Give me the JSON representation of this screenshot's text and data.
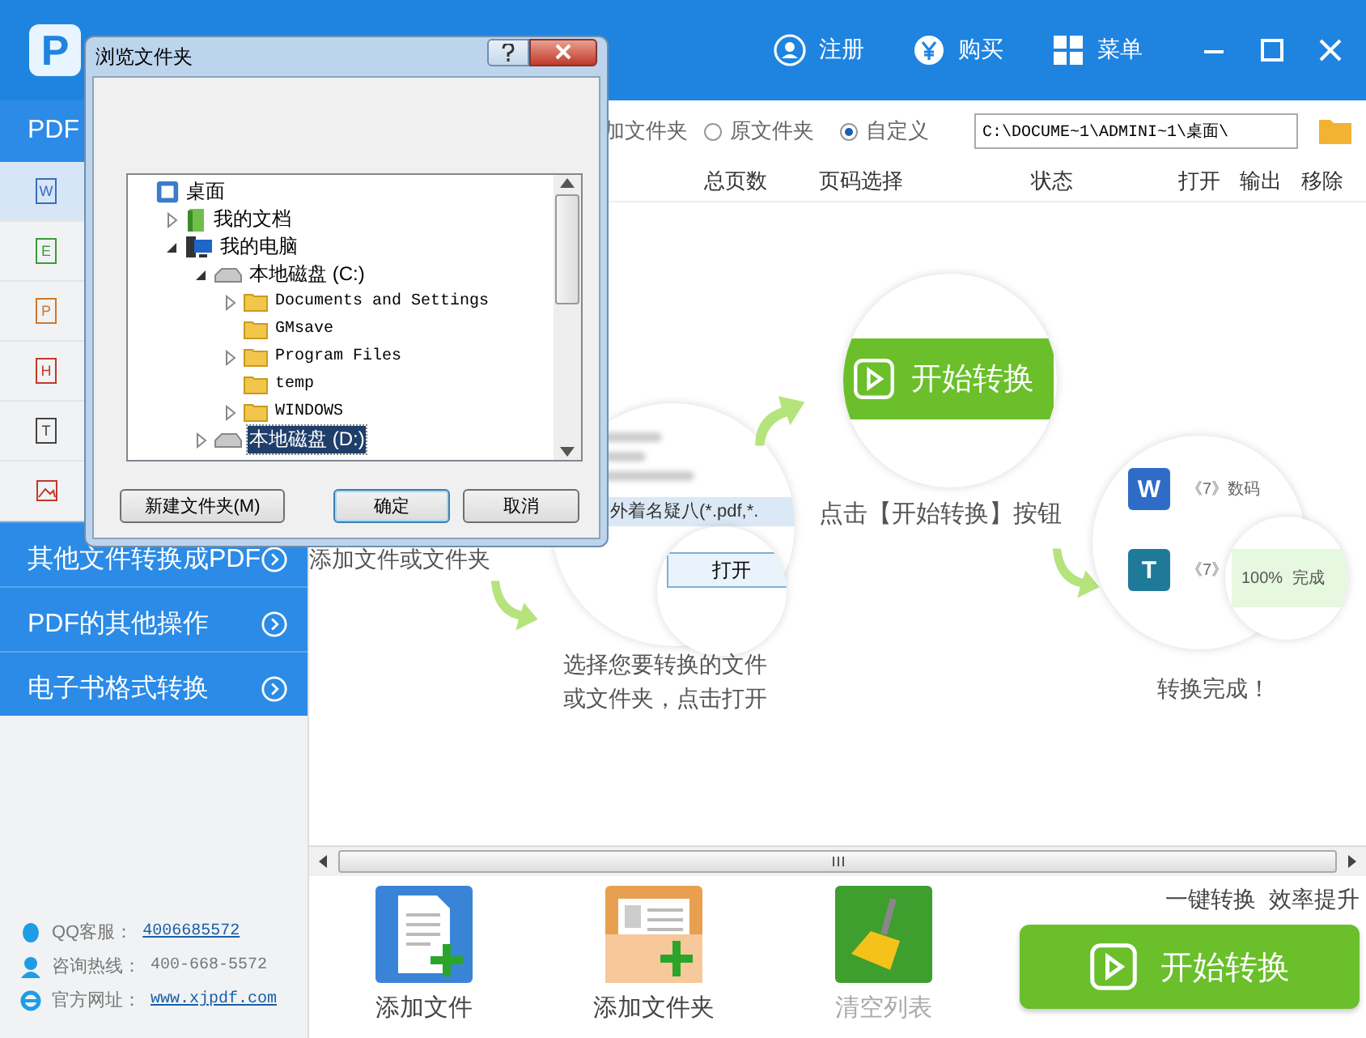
{
  "header": {
    "logo": "P",
    "actions": [
      {
        "label": "注册",
        "kind": "user"
      },
      {
        "label": "购买",
        "kind": "yen"
      },
      {
        "label": "菜单",
        "kind": "grid"
      }
    ]
  },
  "sidebar": {
    "title": "PDF",
    "formats": [
      {
        "kind": "letter",
        "icon": "W",
        "color": "#3a6cc0",
        "selected": true
      },
      {
        "kind": "letter",
        "icon": "E",
        "color": "#3c9a3c",
        "selected": false
      },
      {
        "kind": "letter",
        "icon": "P",
        "color": "#d0782a",
        "selected": false
      },
      {
        "kind": "letter",
        "icon": "H",
        "color": "#c0392b",
        "selected": false
      },
      {
        "kind": "letter",
        "icon": "T",
        "color": "#444444",
        "selected": false
      },
      {
        "kind": "image",
        "color": "#c0392b",
        "selected": false
      }
    ],
    "categories": [
      "其他文件转换成PDF",
      "PDF的其他操作",
      "电子书格式转换"
    ],
    "contact": [
      {
        "kind": "qq",
        "label": "QQ客服：",
        "value": "4006685572",
        "link": true
      },
      {
        "kind": "phone",
        "label": "咨询热线：",
        "value": "400-668-5572",
        "link": false
      },
      {
        "kind": "web",
        "label": "官方网址：",
        "value": "www.xjpdf.com",
        "link": true
      }
    ]
  },
  "output": {
    "label": "加文件夹",
    "options": [
      {
        "label": "原文件夹",
        "selected": false
      },
      {
        "label": "自定义",
        "selected": true
      }
    ],
    "path": "C:\\DOCUME~1\\ADMINI~1\\桌面\\"
  },
  "table": {
    "columns": [
      "总页数",
      "页码选择",
      "状态",
      "打开",
      "输出",
      "移除"
    ]
  },
  "guide": {
    "step1": "添加文件或文件夹",
    "filter": "外着名疑八(*.pdf,*.",
    "open_button": "打开",
    "step2": [
      "选择您要转换的文件",
      "或文件夹，点击打开"
    ],
    "start_bar": "开始转换",
    "step3": "点击【开始转换】按钮",
    "results": [
      {
        "icon": "W",
        "name": "《7》数码"
      },
      {
        "icon": "T",
        "name": "《7》"
      }
    ],
    "progress": "100%",
    "done_label": "完成",
    "step4": "转换完成！"
  },
  "toolbar": {
    "buttons": [
      {
        "kind": "file",
        "label": "添加文件",
        "disabled": false
      },
      {
        "kind": "folder",
        "label": "添加文件夹",
        "disabled": false
      },
      {
        "kind": "clear",
        "label": "清空列表",
        "disabled": true
      }
    ],
    "slogan": "一键转换  效率提升",
    "start": "开始转换"
  },
  "dialog": {
    "title": "浏览文件夹",
    "tree": [
      {
        "kind": "desktop",
        "label": "桌面",
        "selected": false,
        "children": [
          {
            "kind": "docs",
            "label": "我的文档",
            "expanded": false,
            "selected": false
          },
          {
            "kind": "computer",
            "label": "我的电脑",
            "expanded": true,
            "selected": false,
            "children": [
              {
                "kind": "drive",
                "label": "本地磁盘 (C:)",
                "expanded": true,
                "selected": false,
                "children": [
                  {
                    "kind": "folder",
                    "label": "Documents and Settings",
                    "expanded": false,
                    "selected": false
                  },
                  {
                    "kind": "folder",
                    "label": "GMsave",
                    "selected": false
                  },
                  {
                    "kind": "folder",
                    "label": "Program Files",
                    "expanded": false,
                    "selected": false
                  },
                  {
                    "kind": "folder",
                    "label": "temp",
                    "selected": false
                  },
                  {
                    "kind": "folder",
                    "label": "WINDOWS",
                    "expanded": false,
                    "selected": false
                  }
                ]
              },
              {
                "kind": "drive",
                "label": "本地磁盘 (D:)",
                "expanded": false,
                "selected": true
              }
            ]
          }
        ]
      }
    ],
    "buttons": [
      {
        "label": "新建文件夹(M)",
        "default": false
      },
      {
        "label": "确定",
        "default": true
      },
      {
        "label": "取消",
        "default": false
      }
    ]
  }
}
